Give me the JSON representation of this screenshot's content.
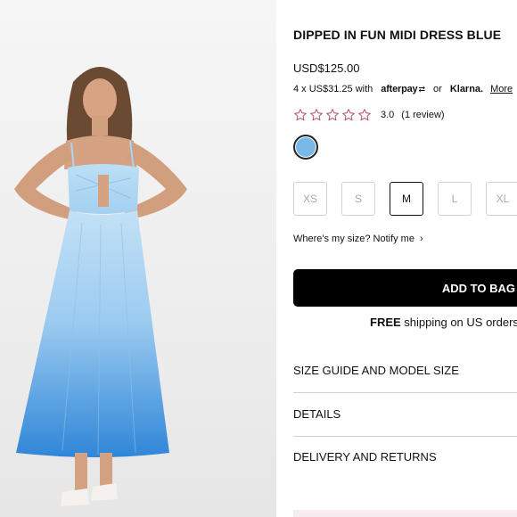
{
  "product": {
    "title": "DIPPED IN FUN MIDI DRESS BLUE",
    "price": "USD$125.00",
    "installments": {
      "text": "4 x US$31.25 with",
      "afterpay": "afterpay",
      "or": "or",
      "klarna": "Klarna.",
      "more": "More"
    },
    "rating": {
      "stars_filled": 0,
      "stars_total": 5,
      "score": "3.0",
      "reviews": "(1 review)"
    },
    "swatch_color": "#7ab8e8",
    "sizes": [
      {
        "label": "XS",
        "selected": false
      },
      {
        "label": "S",
        "selected": false
      },
      {
        "label": "M",
        "selected": true
      },
      {
        "label": "L",
        "selected": false
      },
      {
        "label": "XL",
        "selected": false
      }
    ],
    "size_help": "Where's my size? Notify me",
    "add_to_bag": "ADD TO BAG",
    "shipping": {
      "bold": "FREE",
      "rest": " shipping on US orders"
    },
    "accordion": [
      "SIZE GUIDE AND MODEL SIZE",
      "DETAILS",
      "DELIVERY AND RETURNS"
    ]
  },
  "colors": {
    "star_outline": "#b0485a",
    "dress_top": "#b9dcf4",
    "dress_bottom": "#2f86d8"
  }
}
